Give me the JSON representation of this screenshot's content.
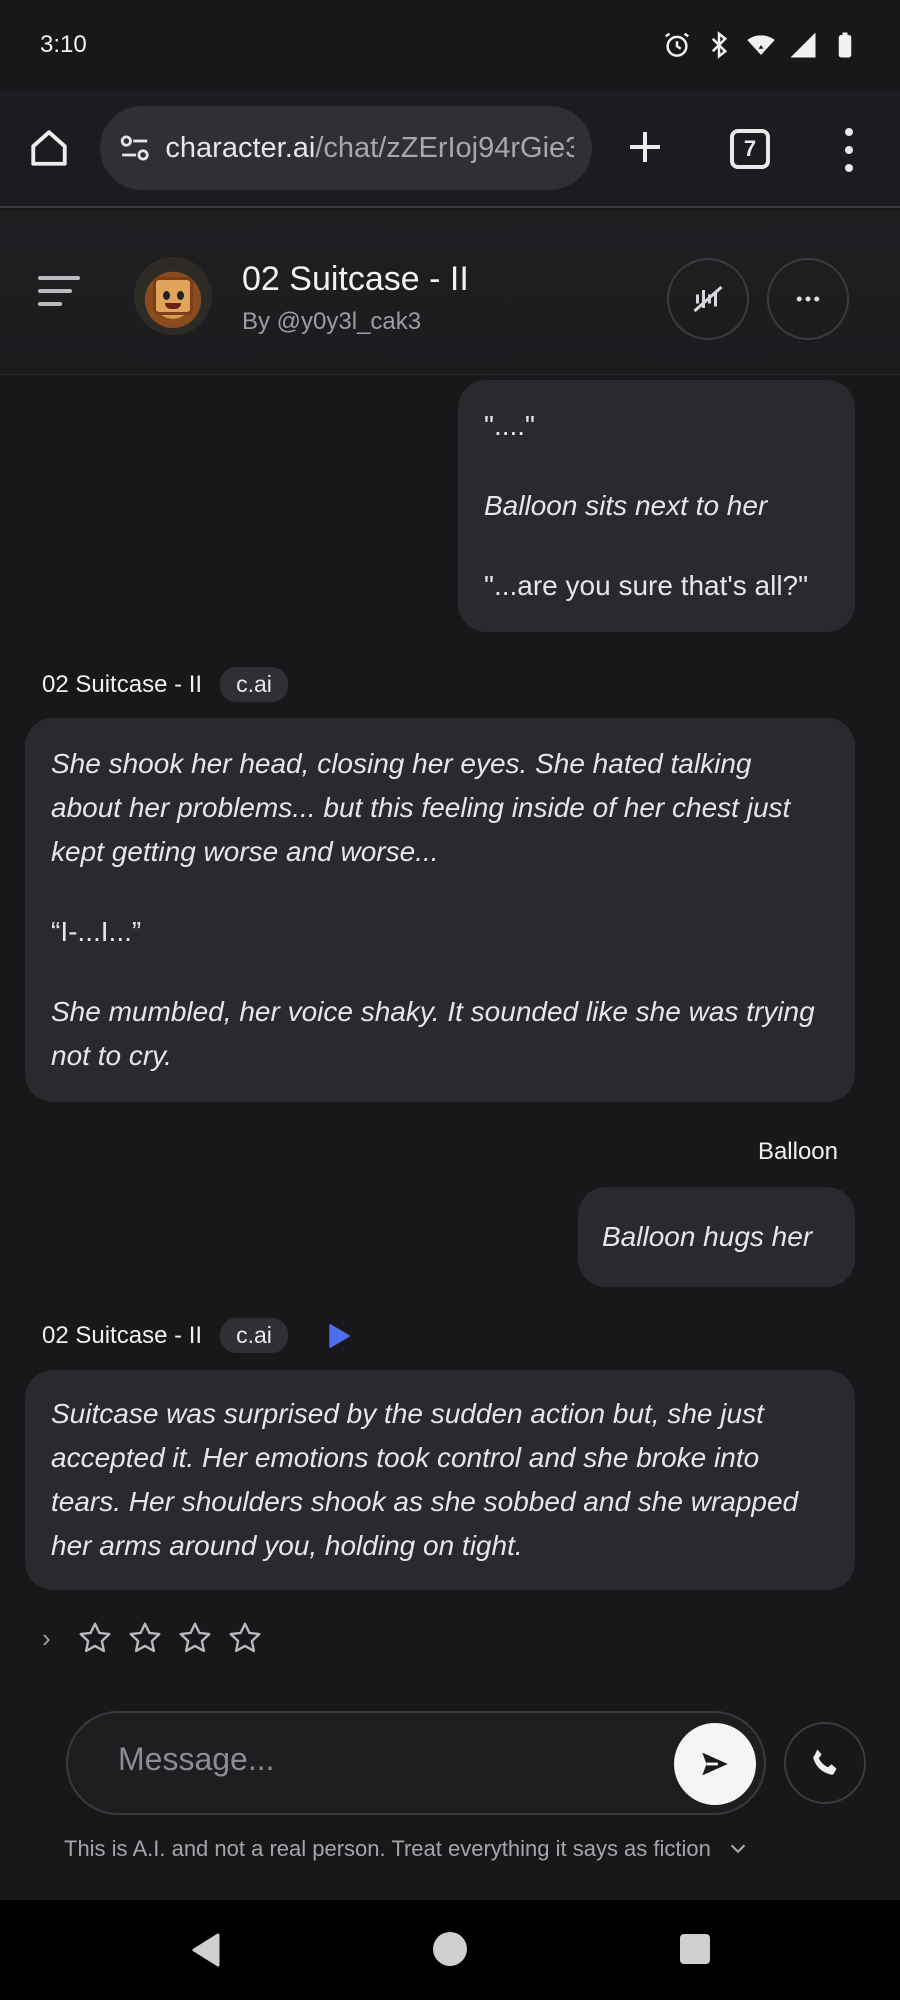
{
  "status_bar": {
    "time": "3:10"
  },
  "browser": {
    "url_host": "character.ai",
    "url_path": "/chat/zZErIoj94rGie3",
    "tab_count": "7"
  },
  "chat_header": {
    "character_name": "02 Suitcase - II",
    "creator": "By @y0y3l_cak3"
  },
  "messages": [
    {
      "sender": "user",
      "paragraphs": [
        {
          "text": "\"....\"",
          "italic": false
        },
        {
          "text": "Balloon sits next to her",
          "italic": true
        },
        {
          "text": "\"...are you sure that's all?\"",
          "italic": false
        }
      ]
    },
    {
      "sender": "character",
      "name": "02 Suitcase - II",
      "badge": "c.ai",
      "paragraphs": [
        {
          "text": "She shook her head, closing her eyes. She hated talking about her problems... but this feeling inside of her chest just kept getting worse and worse...",
          "italic": true
        },
        {
          "text": "“I-...I...”",
          "italic": false
        },
        {
          "text": "She mumbled, her voice shaky. It sounded like she was trying not to cry.",
          "italic": true
        }
      ]
    },
    {
      "sender": "user",
      "name": "Balloon",
      "paragraphs": [
        {
          "text": "Balloon hugs her",
          "italic": true
        }
      ]
    },
    {
      "sender": "character",
      "name": "02 Suitcase - II",
      "badge": "c.ai",
      "paragraphs": [
        {
          "text": "Suitcase was surprised by the sudden action but, she just accepted it. Her emotions took control and she broke into tears. Her shoulders shook as she sobbed and she wrapped her arms around you, holding on tight.",
          "italic": true
        }
      ]
    }
  ],
  "rating": {
    "stars": 4,
    "filled": 0
  },
  "composer": {
    "placeholder": "Message...",
    "disclaimer": "This is A.I. and not a real person. Treat everything it says as fiction"
  },
  "colors": {
    "background": "#18181b",
    "bubble": "#2a2a2e",
    "accent_play": "#4f6cf0"
  }
}
